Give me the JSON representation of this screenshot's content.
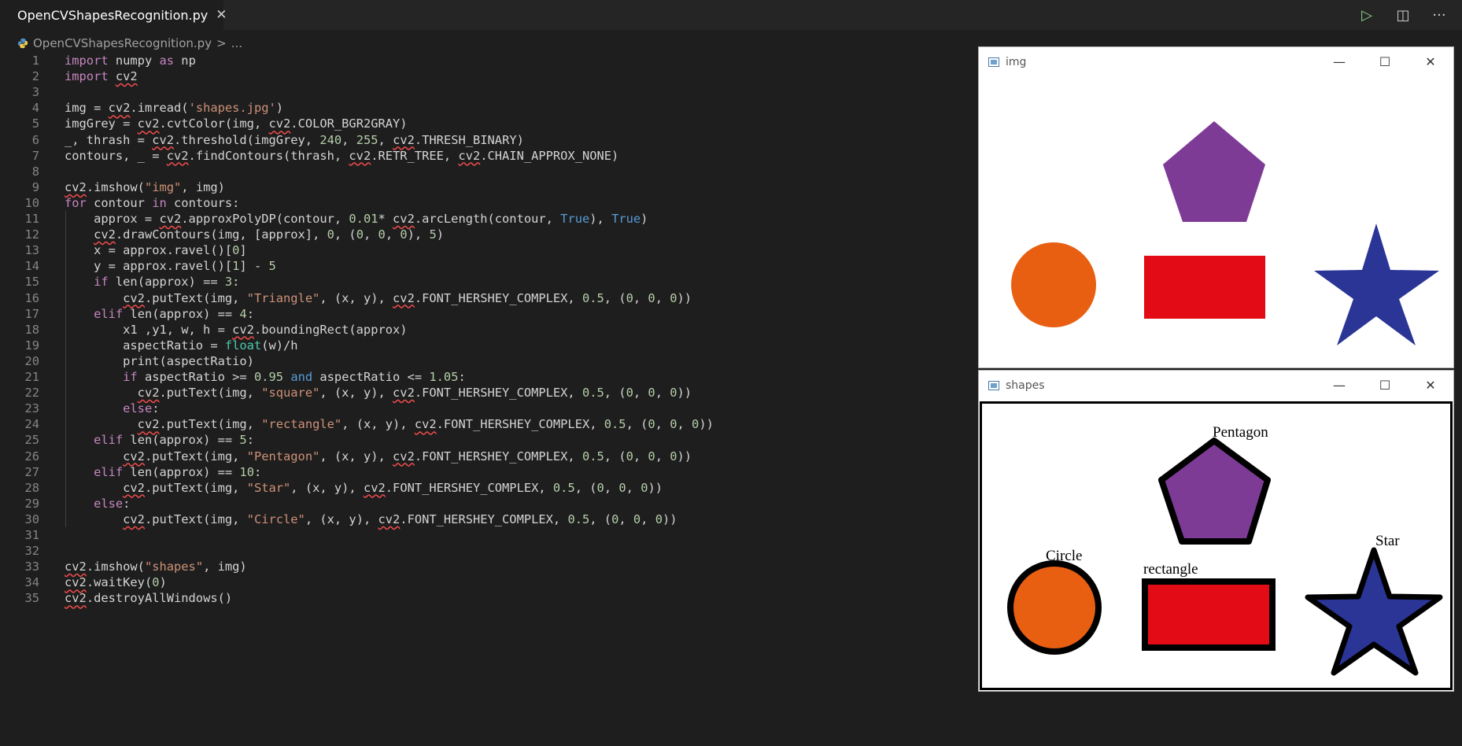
{
  "tab": {
    "filename": "OpenCVShapesRecognition.py",
    "close": "✕"
  },
  "top_actions": {
    "run": "▷",
    "split": "◫",
    "more": "···"
  },
  "breadcrumb": {
    "file": "OpenCVShapesRecognition.py",
    "sep": ">",
    "more": "..."
  },
  "code_lines": [
    "import numpy as np",
    "import cv2",
    "",
    "img = cv2.imread('shapes.jpg')",
    "imgGrey = cv2.cvtColor(img, cv2.COLOR_BGR2GRAY)",
    "_, thrash = cv2.threshold(imgGrey, 240, 255, cv2.THRESH_BINARY)",
    "contours, _ = cv2.findContours(thrash, cv2.RETR_TREE, cv2.CHAIN_APPROX_NONE)",
    "",
    "cv2.imshow(\"img\", img)",
    "for contour in contours:",
    "    approx = cv2.approxPolyDP(contour, 0.01* cv2.arcLength(contour, True), True)",
    "    cv2.drawContours(img, [approx], 0, (0, 0, 0), 5)",
    "    x = approx.ravel()[0]",
    "    y = approx.ravel()[1] - 5",
    "    if len(approx) == 3:",
    "        cv2.putText(img, \"Triangle\", (x, y), cv2.FONT_HERSHEY_COMPLEX, 0.5, (0, 0, 0))",
    "    elif len(approx) == 4:",
    "        x1 ,y1, w, h = cv2.boundingRect(approx)",
    "        aspectRatio = float(w)/h",
    "        print(aspectRatio)",
    "        if aspectRatio >= 0.95 and aspectRatio <= 1.05:",
    "          cv2.putText(img, \"square\", (x, y), cv2.FONT_HERSHEY_COMPLEX, 0.5, (0, 0, 0))",
    "        else:",
    "          cv2.putText(img, \"rectangle\", (x, y), cv2.FONT_HERSHEY_COMPLEX, 0.5, (0, 0, 0))",
    "    elif len(approx) == 5:",
    "        cv2.putText(img, \"Pentagon\", (x, y), cv2.FONT_HERSHEY_COMPLEX, 0.5, (0, 0, 0))",
    "    elif len(approx) == 10:",
    "        cv2.putText(img, \"Star\", (x, y), cv2.FONT_HERSHEY_COMPLEX, 0.5, (0, 0, 0))",
    "    else:",
    "        cv2.putText(img, \"Circle\", (x, y), cv2.FONT_HERSHEY_COMPLEX, 0.5, (0, 0, 0))",
    "",
    "",
    "cv2.imshow(\"shapes\", img)",
    "cv2.waitKey(0)",
    "cv2.destroyAllWindows()"
  ],
  "windows": {
    "img": {
      "title": "img"
    },
    "shapes": {
      "title": "shapes",
      "labels": {
        "pentagon": "Pentagon",
        "circle": "Circle",
        "rectangle": "rectangle",
        "star": "Star"
      }
    },
    "controls": {
      "minimize": "—",
      "maximize": "☐",
      "close": "✕"
    }
  },
  "colors": {
    "pentagon": "#7e3b96",
    "circle": "#e85f12",
    "rectangle": "#e30b16",
    "star": "#2b3596",
    "keyword": "#c586c0",
    "builtin": "#569cd6",
    "string": "#ce9178",
    "number": "#b5cea8"
  }
}
